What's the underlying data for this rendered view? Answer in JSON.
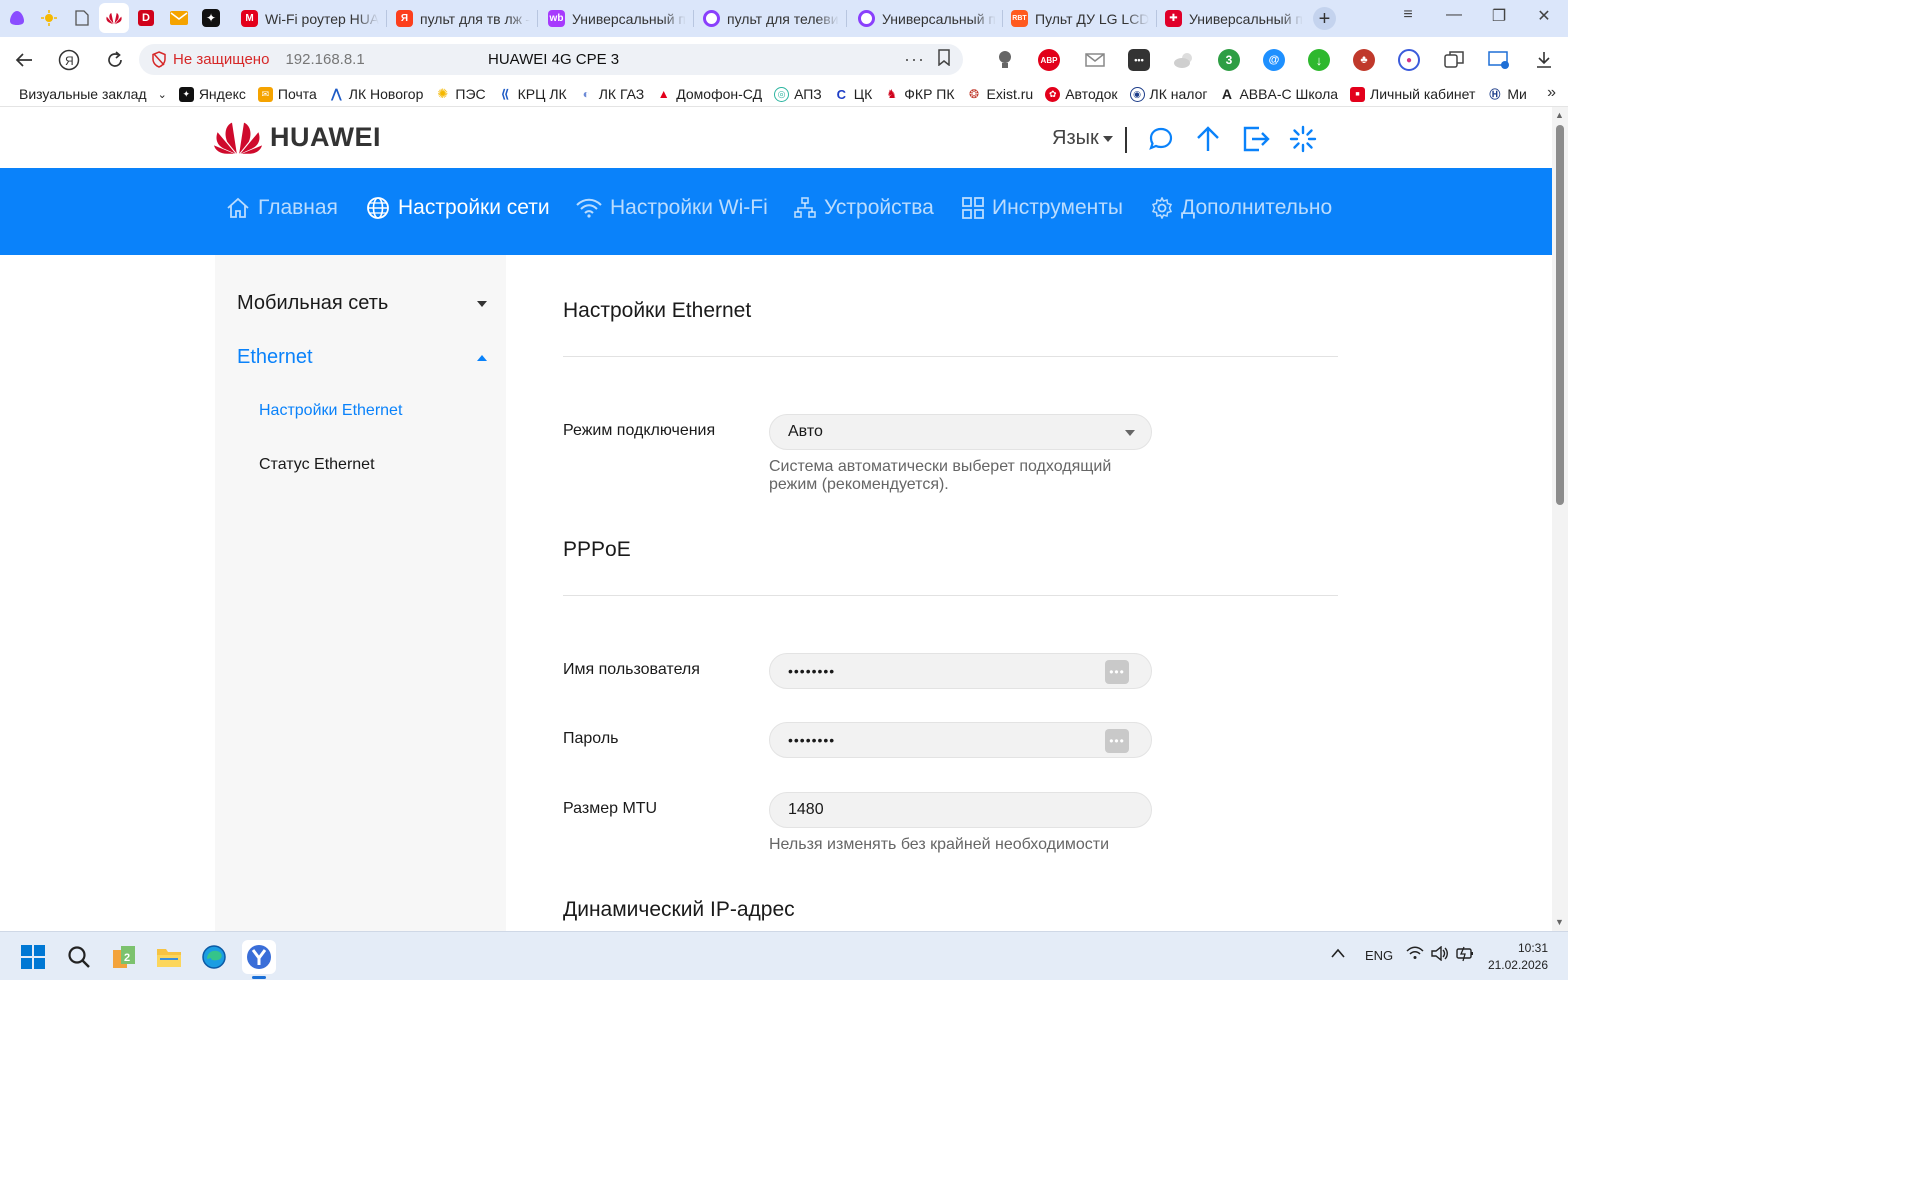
{
  "browser": {
    "tabs": [
      {
        "label": "Wi-Fi роутер HUA"
      },
      {
        "label": "пульт для тв лж –"
      },
      {
        "label": "Универсальный п"
      },
      {
        "label": "пульт для телеви"
      },
      {
        "label": "Универсальный п"
      },
      {
        "label": "Пульт ДУ LG LCD"
      },
      {
        "label": "Универсальный п"
      }
    ],
    "security_label": "Не защищено",
    "address": "192.168.8.1",
    "page_title": "HUAWEI 4G CPE 3",
    "bookmarks": [
      "Визуальные заклад",
      "Яндекс",
      "Почта",
      "ЛК Новогор",
      "ПЭС",
      "КРЦ ЛК",
      "ЛК ГАЗ",
      "Домофон-СД",
      "АПЗ",
      "ЦК",
      "ФКР ПК",
      "Exist.ru",
      "Автодок",
      "ЛК налог",
      "ABBA-C Школа",
      "Личный кабинет",
      "Ми"
    ]
  },
  "router": {
    "brand": "HUAWEI",
    "language_label": "Язык",
    "nav": [
      {
        "label": "Главная",
        "icon": "home-icon"
      },
      {
        "label": "Настройки сети",
        "icon": "globe-icon"
      },
      {
        "label": "Настройки Wi-Fi",
        "icon": "wifi-icon"
      },
      {
        "label": "Устройства",
        "icon": "devices-icon"
      },
      {
        "label": "Инструменты",
        "icon": "tools-icon"
      },
      {
        "label": "Дополнительно",
        "icon": "gear-icon"
      }
    ],
    "sidebar": {
      "groups": [
        {
          "label": "Мобильная сеть"
        },
        {
          "label": "Ethernet",
          "items": [
            {
              "label": "Настройки Ethernet"
            },
            {
              "label": "Статус Ethernet"
            }
          ]
        }
      ]
    },
    "content": {
      "title": "Настройки Ethernet",
      "mode_label": "Режим подключения",
      "mode_value": "Авто",
      "mode_hint": "Система автоматически выберет подходящий режим (рекомендуется).",
      "pppoe_title": "PPPoE",
      "username_label": "Имя пользователя",
      "username_value": "••••••••",
      "password_label": "Пароль",
      "password_value": "••••••••",
      "mtu_label": "Размер MTU",
      "mtu_value": "1480",
      "mtu_hint": "Нельзя изменять без крайней необходимости",
      "dynamic_title": "Динамический IP-адрес"
    }
  },
  "taskbar": {
    "language": "ENG",
    "time": "10:31",
    "date": "21.02.2026"
  },
  "colors": {
    "accent": "#0a82fa",
    "huawei_red": "#cf0a2c",
    "tabstrip": "#dbe6fa"
  }
}
